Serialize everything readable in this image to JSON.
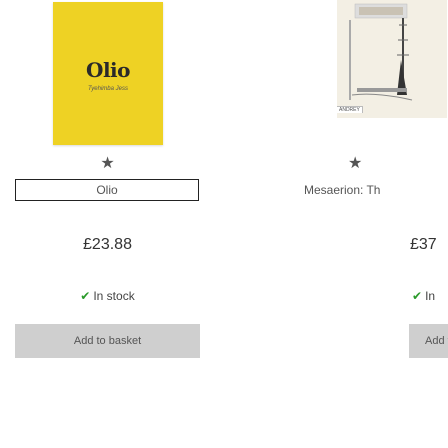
{
  "products": [
    {
      "cover": {
        "title": "Olio",
        "author": "Tyehimba Jess"
      },
      "rating_icon": "star-icon",
      "rating_glyph": "★",
      "title": "Olio",
      "price": "£23.88",
      "stock": {
        "icon": "check-icon",
        "glyph": "✔",
        "label": "In stock"
      },
      "button_label": "Add to basket"
    },
    {
      "cover": {
        "caption": "ANDREY"
      },
      "rating_icon": "star-icon",
      "rating_glyph": "★",
      "title": "Mesaerion: Th",
      "price": "£37",
      "stock": {
        "icon": "check-icon",
        "glyph": "✔",
        "label": "In"
      },
      "button_label": "Add to"
    }
  ],
  "colors": {
    "cover_olio": "#eed224",
    "button_bg": "#cfcfcf",
    "check": "#2a9a2a"
  }
}
